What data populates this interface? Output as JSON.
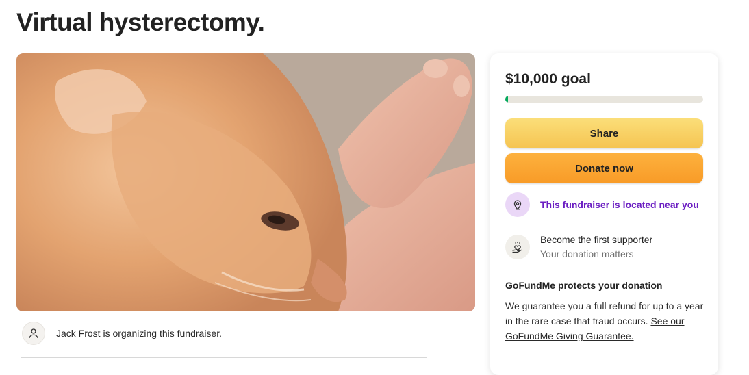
{
  "page": {
    "title": "Virtual hysterectomy."
  },
  "organizer": {
    "text": "Jack Frost is organizing this fundraiser.",
    "avatar_icon": "person-icon"
  },
  "donation_card": {
    "goal_text": "$10,000 goal",
    "progress_fraction": 0.015,
    "share_label": "Share",
    "donate_label": "Donate now",
    "location_text": "This fundraiser is located near you",
    "location_icon": "map-pin-icon",
    "supporter_title": "Become the first supporter",
    "supporter_subtitle": "Your donation matters",
    "supporter_icon": "heart-hand-icon",
    "protect_title": "GoFundMe protects your donation",
    "protect_body": "We guarantee you a full refund for up to a year in the rare case that fraud occurs.",
    "protect_link": "See our GoFundMe Giving Guarantee.",
    "colors": {
      "progress": "#02a95c",
      "share": "#f5c451",
      "donate": "#f89b27",
      "location_text": "#6b1ec2"
    }
  }
}
